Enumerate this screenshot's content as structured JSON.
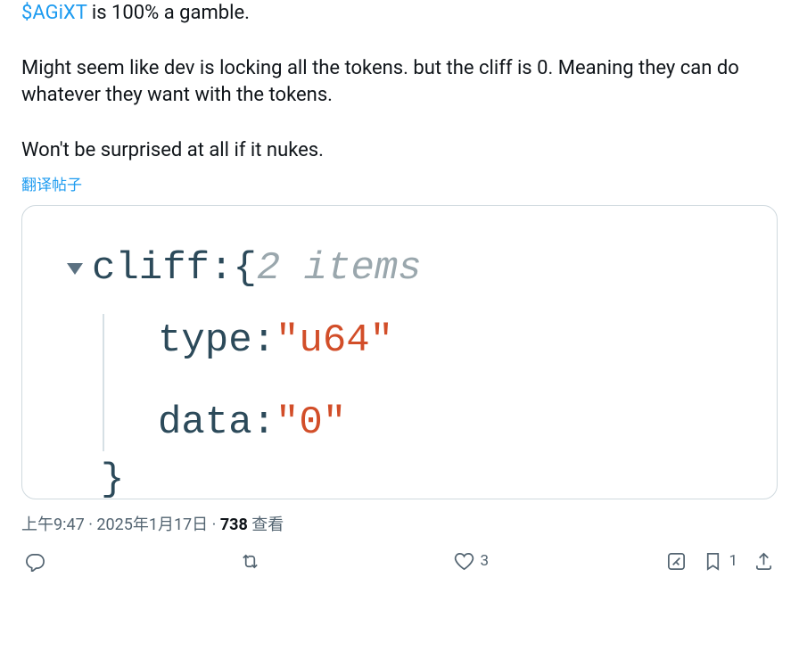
{
  "tweet": {
    "cashtag": "$AGiXT",
    "text_after_cashtag": " is 100% a gamble.",
    "paragraph2": "Might seem like dev is locking all the tokens. but the cliff is 0. Meaning they can do whatever they want with the tokens.",
    "paragraph3": "Won't be surprised at all if it nukes."
  },
  "translate": "翻译帖子",
  "media": {
    "json_key": "cliff",
    "json_colon": " : ",
    "json_brace": "{ ",
    "json_meta": "2 items",
    "row_type_key": "type",
    "row_type_colon": " : ",
    "row_type_value": "\"u64\"",
    "row_data_key": "data",
    "row_data_colon": " : ",
    "row_data_value": "\"0\"",
    "close_brace": "}"
  },
  "timestamp": {
    "time": "上午9:47",
    "date": "2025年1月17日",
    "views_number": "738",
    "views_label": "查看"
  },
  "actions": {
    "reply_count": "",
    "retweet_count": "",
    "like_count": "3",
    "bookmark_count": "1"
  }
}
